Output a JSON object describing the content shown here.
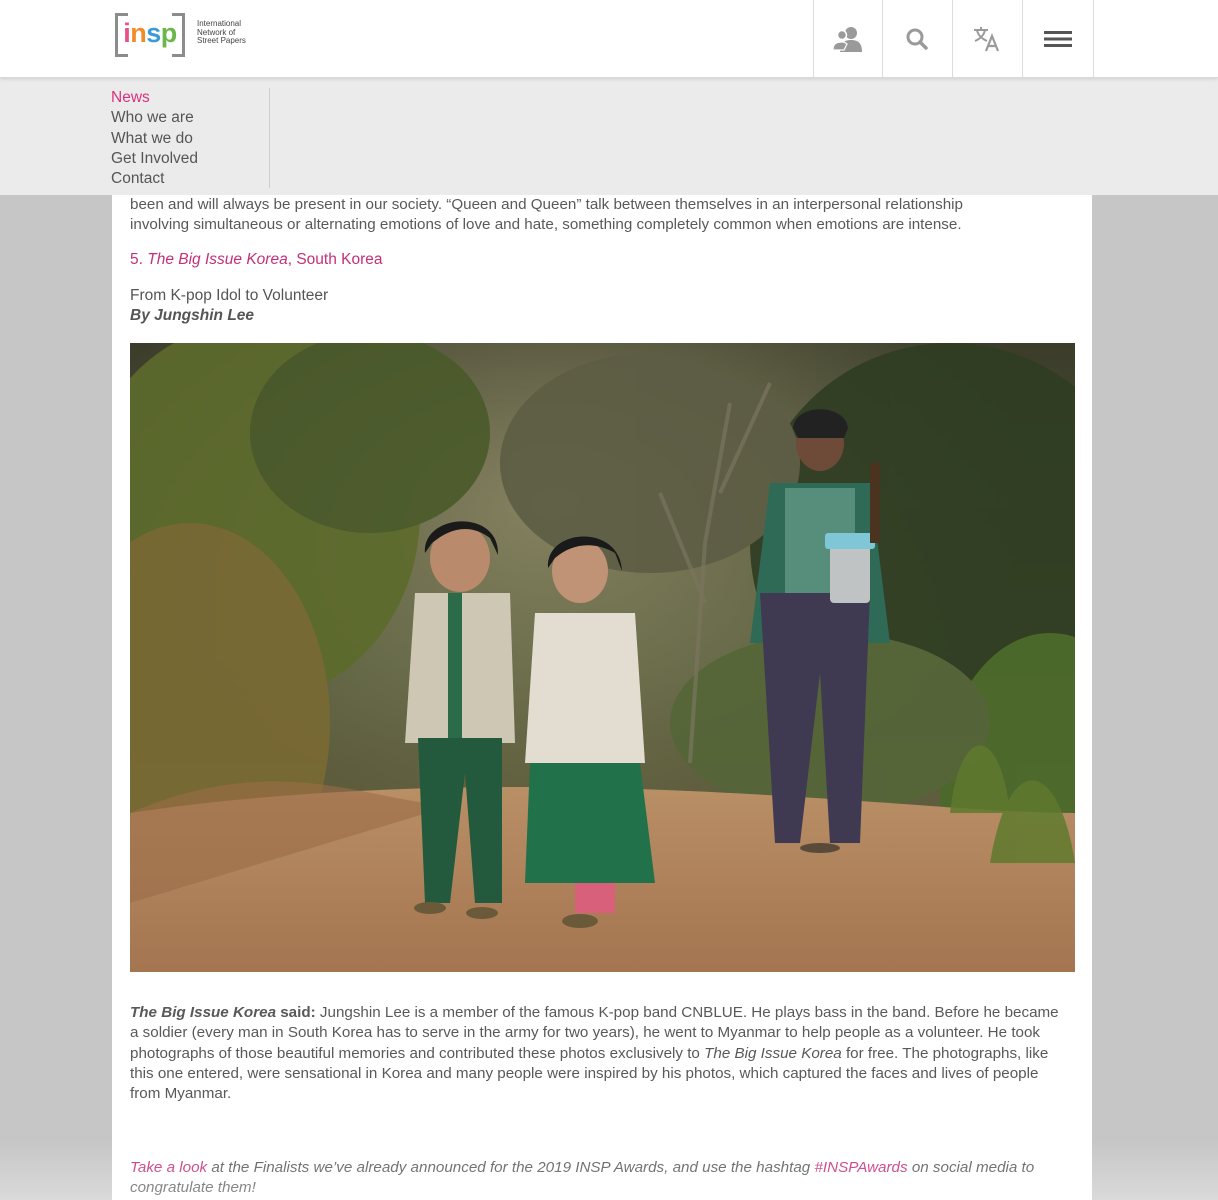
{
  "logo": {
    "wordmark": "insp",
    "tagline": [
      "International",
      "Network of",
      "Street Papers"
    ]
  },
  "header_buttons": [
    {
      "name": "account",
      "icon": "users-icon"
    },
    {
      "name": "search",
      "icon": "search-icon"
    },
    {
      "name": "translate",
      "icon": "translate-icon"
    },
    {
      "name": "menu",
      "icon": "hamburger-menu-icon"
    }
  ],
  "nav": {
    "items": [
      {
        "label": "News",
        "active": true
      },
      {
        "label": "Who we are",
        "active": false
      },
      {
        "label": "What we do",
        "active": false
      },
      {
        "label": "Get Involved",
        "active": false
      },
      {
        "label": "Contact",
        "active": false
      }
    ]
  },
  "article": {
    "intro_line1": "been and will always be present in our society. “Queen and Queen” talk between themselves in an interpersonal relationship",
    "intro_line2": "involving simultaneous or alternating emotions of love and hate, something completely common when emotions are intense.",
    "entry_number": "5.",
    "entry_paper": "The Big Issue Korea",
    "entry_country": ", South Korea",
    "story_title": "From K-pop Idol to Volunteer",
    "story_byline": "By Jungshin Lee",
    "photo_alt": "Two young girls in green and white clothes walking and laughing on a dirt path, a woman carrying a tiffin walking behind them, with jungle trees in the background",
    "said_paper": "The Big Issue Korea",
    "said_label": " said:",
    "said_text_1": " Jungshin Lee is a member of the famous K-pop band CNBLUE. He plays bass in the band. Before he became a soldier (every man in South Korea has to serve in the army for two years), he went to Myanmar to help people as a volunteer. He took photographs of those beautiful memories and contributed these photos exclusively to ",
    "said_paper_2": "The Big Issue Korea",
    "said_text_2": " for free. The photographs, like this one entered, were sensational in Korea and many people were inspired by his photos, which captured the faces and lives of people from Myanmar.",
    "cta_link": "Take a look",
    "cta_text_1": " at the Finalists we’ve already announced for the 2019 INSP Awards, and use the hashtag ",
    "cta_hashtag": "#INSPAwards",
    "cta_text_2": " on social media to congratulate them!"
  },
  "colors": {
    "accent_pink": "#c42f78",
    "nav_active": "#d9337b",
    "logo_i": "#e94f8a",
    "logo_n": "#f28c2a",
    "logo_s": "#3a9ad9",
    "logo_p": "#6bb84a"
  }
}
